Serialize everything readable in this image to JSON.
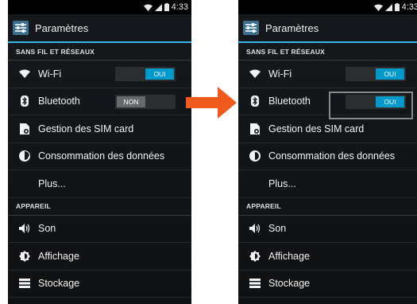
{
  "colors": {
    "accent": "#33b5e5",
    "toggle_on": "#0099cc",
    "arrow": "#f05a1f"
  },
  "left": {
    "status_time": "4:33",
    "title": "Paramètres",
    "sections": {
      "wireless": "SANS FIL ET RÉSEAUX",
      "device": "APPAREIL"
    },
    "items": {
      "wifi": "Wi-Fi",
      "bluetooth": "Bluetooth",
      "sim": "Gestion des SIM card",
      "data": "Consommation des données",
      "more": "Plus...",
      "sound": "Son",
      "display": "Affichage",
      "storage": "Stockage"
    },
    "wifi_toggle": "OUI",
    "bluetooth_toggle": "NON"
  },
  "right": {
    "status_time": "4:33",
    "title": "Paramètres",
    "sections": {
      "wireless": "SANS FIL ET RÉSEAUX",
      "device": "APPAREIL"
    },
    "items": {
      "wifi": "Wi-Fi",
      "bluetooth": "Bluetooth",
      "sim": "Gestion des SIM card",
      "data": "Consommation des données",
      "more": "Plus...",
      "sound": "Son",
      "display": "Affichage",
      "storage": "Stockage"
    },
    "wifi_toggle": "OUI",
    "bluetooth_toggle": "OUI"
  }
}
